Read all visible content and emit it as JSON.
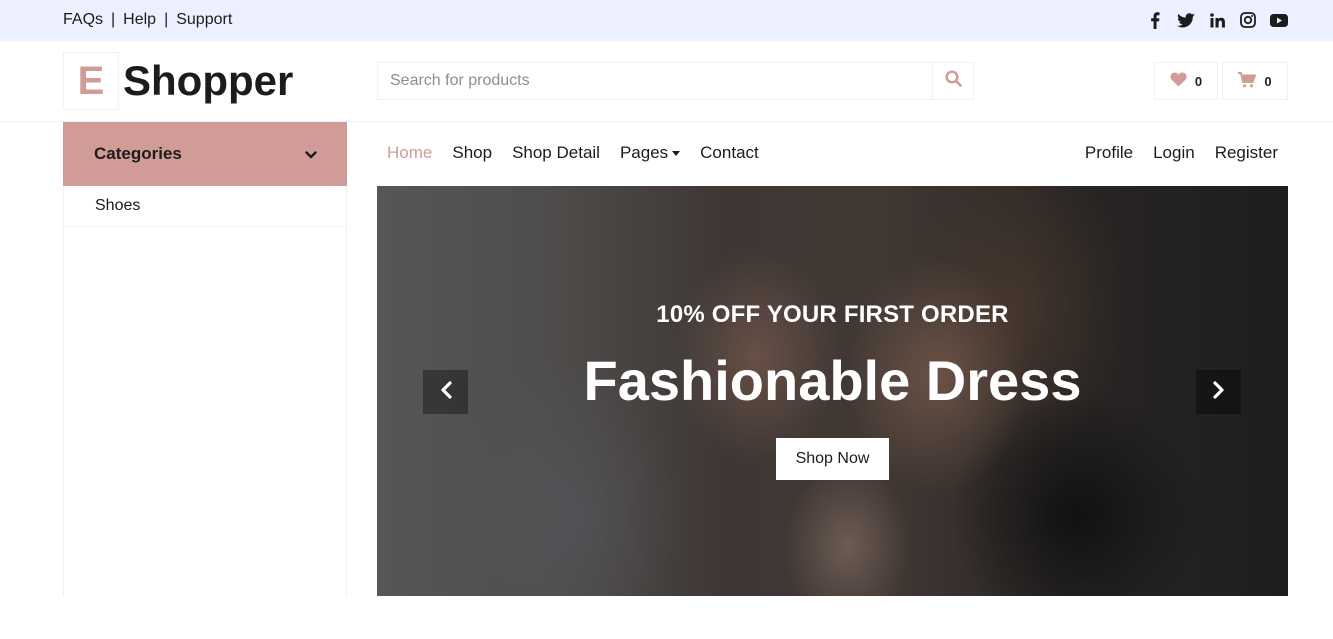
{
  "topbar": {
    "links": [
      "FAQs",
      "Help",
      "Support"
    ],
    "separator": "|",
    "socials": [
      "facebook-icon",
      "twitter-icon",
      "linkedin-icon",
      "instagram-icon",
      "youtube-icon"
    ]
  },
  "header": {
    "logo_letter": "E",
    "logo_text": "Shopper",
    "search_placeholder": "Search for products",
    "wishlist_count": "0",
    "cart_count": "0"
  },
  "categories": {
    "title": "Categories",
    "items": [
      "Shoes"
    ]
  },
  "nav": {
    "items": [
      "Home",
      "Shop",
      "Shop Detail",
      "Pages",
      "Contact"
    ],
    "active": "Home",
    "right": [
      "Profile",
      "Login",
      "Register"
    ]
  },
  "hero": {
    "subtitle": "10% OFF YOUR FIRST ORDER",
    "title": "Fashionable Dress",
    "cta": "Shop Now"
  },
  "colors": {
    "primary": "#d19c97",
    "secondary": "#edf1ff",
    "text": "#1c1c1c"
  }
}
